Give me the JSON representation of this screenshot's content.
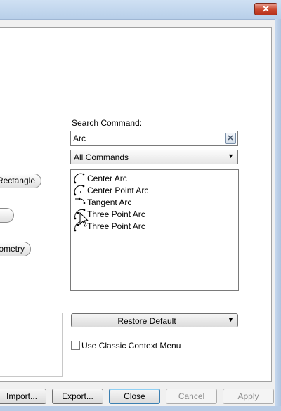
{
  "window": {
    "close_glyph": "✕"
  },
  "left_buttons": {
    "rectangle_label": "Rectangle",
    "blank_label": "",
    "geometry_label": "Geometry"
  },
  "search": {
    "label": "Search Command:",
    "value": "Arc",
    "clear_icon": "clear-icon"
  },
  "filter": {
    "selected": "All Commands"
  },
  "commands": [
    {
      "label": "Center Arc",
      "icon": "center-arc-icon"
    },
    {
      "label": "Center Point Arc",
      "icon": "center-point-arc-icon"
    },
    {
      "label": "Tangent Arc",
      "icon": "tangent-arc-icon"
    },
    {
      "label": "Three Point Arc",
      "icon": "three-point-arc-icon"
    },
    {
      "label": "Three Point Arc",
      "icon": "three-point-arc-icon"
    }
  ],
  "restore": {
    "label": "Restore Default"
  },
  "classic_menu": {
    "label": "Use Classic Context Menu",
    "checked": false
  },
  "footer_buttons": {
    "import": "Import...",
    "export": "Export...",
    "close": "Close",
    "cancel": "Cancel",
    "apply": "Apply"
  }
}
